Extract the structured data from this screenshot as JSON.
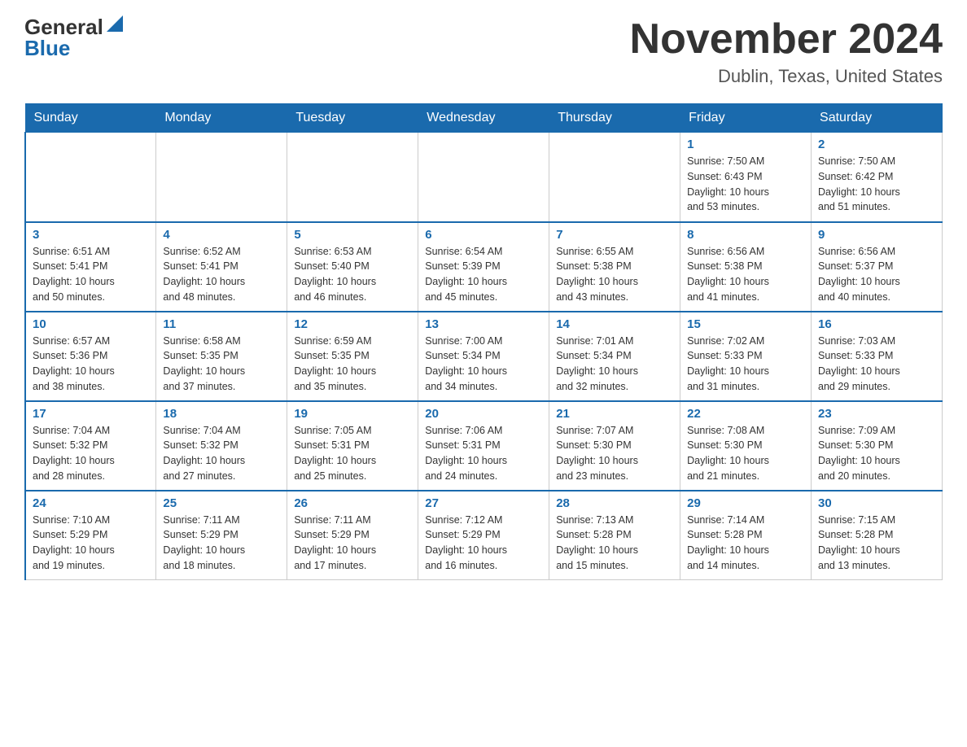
{
  "header": {
    "logo_general": "General",
    "logo_blue": "Blue",
    "month_title": "November 2024",
    "location": "Dublin, Texas, United States"
  },
  "days_of_week": [
    "Sunday",
    "Monday",
    "Tuesday",
    "Wednesday",
    "Thursday",
    "Friday",
    "Saturday"
  ],
  "weeks": [
    [
      {
        "day": "",
        "info": ""
      },
      {
        "day": "",
        "info": ""
      },
      {
        "day": "",
        "info": ""
      },
      {
        "day": "",
        "info": ""
      },
      {
        "day": "",
        "info": ""
      },
      {
        "day": "1",
        "info": "Sunrise: 7:50 AM\nSunset: 6:43 PM\nDaylight: 10 hours\nand 53 minutes."
      },
      {
        "day": "2",
        "info": "Sunrise: 7:50 AM\nSunset: 6:42 PM\nDaylight: 10 hours\nand 51 minutes."
      }
    ],
    [
      {
        "day": "3",
        "info": "Sunrise: 6:51 AM\nSunset: 5:41 PM\nDaylight: 10 hours\nand 50 minutes."
      },
      {
        "day": "4",
        "info": "Sunrise: 6:52 AM\nSunset: 5:41 PM\nDaylight: 10 hours\nand 48 minutes."
      },
      {
        "day": "5",
        "info": "Sunrise: 6:53 AM\nSunset: 5:40 PM\nDaylight: 10 hours\nand 46 minutes."
      },
      {
        "day": "6",
        "info": "Sunrise: 6:54 AM\nSunset: 5:39 PM\nDaylight: 10 hours\nand 45 minutes."
      },
      {
        "day": "7",
        "info": "Sunrise: 6:55 AM\nSunset: 5:38 PM\nDaylight: 10 hours\nand 43 minutes."
      },
      {
        "day": "8",
        "info": "Sunrise: 6:56 AM\nSunset: 5:38 PM\nDaylight: 10 hours\nand 41 minutes."
      },
      {
        "day": "9",
        "info": "Sunrise: 6:56 AM\nSunset: 5:37 PM\nDaylight: 10 hours\nand 40 minutes."
      }
    ],
    [
      {
        "day": "10",
        "info": "Sunrise: 6:57 AM\nSunset: 5:36 PM\nDaylight: 10 hours\nand 38 minutes."
      },
      {
        "day": "11",
        "info": "Sunrise: 6:58 AM\nSunset: 5:35 PM\nDaylight: 10 hours\nand 37 minutes."
      },
      {
        "day": "12",
        "info": "Sunrise: 6:59 AM\nSunset: 5:35 PM\nDaylight: 10 hours\nand 35 minutes."
      },
      {
        "day": "13",
        "info": "Sunrise: 7:00 AM\nSunset: 5:34 PM\nDaylight: 10 hours\nand 34 minutes."
      },
      {
        "day": "14",
        "info": "Sunrise: 7:01 AM\nSunset: 5:34 PM\nDaylight: 10 hours\nand 32 minutes."
      },
      {
        "day": "15",
        "info": "Sunrise: 7:02 AM\nSunset: 5:33 PM\nDaylight: 10 hours\nand 31 minutes."
      },
      {
        "day": "16",
        "info": "Sunrise: 7:03 AM\nSunset: 5:33 PM\nDaylight: 10 hours\nand 29 minutes."
      }
    ],
    [
      {
        "day": "17",
        "info": "Sunrise: 7:04 AM\nSunset: 5:32 PM\nDaylight: 10 hours\nand 28 minutes."
      },
      {
        "day": "18",
        "info": "Sunrise: 7:04 AM\nSunset: 5:32 PM\nDaylight: 10 hours\nand 27 minutes."
      },
      {
        "day": "19",
        "info": "Sunrise: 7:05 AM\nSunset: 5:31 PM\nDaylight: 10 hours\nand 25 minutes."
      },
      {
        "day": "20",
        "info": "Sunrise: 7:06 AM\nSunset: 5:31 PM\nDaylight: 10 hours\nand 24 minutes."
      },
      {
        "day": "21",
        "info": "Sunrise: 7:07 AM\nSunset: 5:30 PM\nDaylight: 10 hours\nand 23 minutes."
      },
      {
        "day": "22",
        "info": "Sunrise: 7:08 AM\nSunset: 5:30 PM\nDaylight: 10 hours\nand 21 minutes."
      },
      {
        "day": "23",
        "info": "Sunrise: 7:09 AM\nSunset: 5:30 PM\nDaylight: 10 hours\nand 20 minutes."
      }
    ],
    [
      {
        "day": "24",
        "info": "Sunrise: 7:10 AM\nSunset: 5:29 PM\nDaylight: 10 hours\nand 19 minutes."
      },
      {
        "day": "25",
        "info": "Sunrise: 7:11 AM\nSunset: 5:29 PM\nDaylight: 10 hours\nand 18 minutes."
      },
      {
        "day": "26",
        "info": "Sunrise: 7:11 AM\nSunset: 5:29 PM\nDaylight: 10 hours\nand 17 minutes."
      },
      {
        "day": "27",
        "info": "Sunrise: 7:12 AM\nSunset: 5:29 PM\nDaylight: 10 hours\nand 16 minutes."
      },
      {
        "day": "28",
        "info": "Sunrise: 7:13 AM\nSunset: 5:28 PM\nDaylight: 10 hours\nand 15 minutes."
      },
      {
        "day": "29",
        "info": "Sunrise: 7:14 AM\nSunset: 5:28 PM\nDaylight: 10 hours\nand 14 minutes."
      },
      {
        "day": "30",
        "info": "Sunrise: 7:15 AM\nSunset: 5:28 PM\nDaylight: 10 hours\nand 13 minutes."
      }
    ]
  ]
}
